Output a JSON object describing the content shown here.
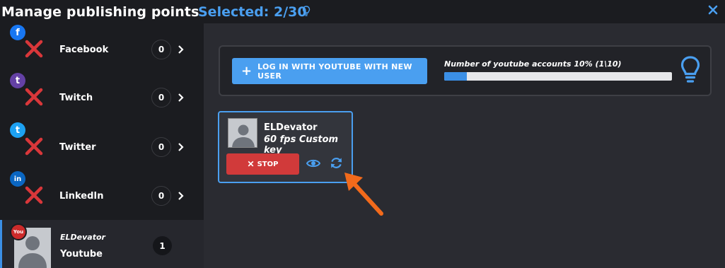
{
  "header": {
    "title": "Manage publishing points",
    "selected": "Selected: 2/30"
  },
  "sidebar": {
    "items": [
      {
        "name": "Facebook",
        "count": "0",
        "brand_icon": "facebook-icon",
        "brand_letter": "f",
        "color": "#1877f2"
      },
      {
        "name": "Twitch",
        "count": "0",
        "brand_icon": "twitch-icon",
        "brand_letter": "t",
        "color": "#6441a5"
      },
      {
        "name": "Twitter",
        "count": "0",
        "brand_icon": "twitter-icon",
        "brand_letter": "t",
        "color": "#1da1f2"
      },
      {
        "name": "LinkedIn",
        "count": "0",
        "brand_icon": "linkedin-icon",
        "brand_letter": "in",
        "color": "#0a66c2"
      }
    ],
    "active": {
      "account": "ELDevator",
      "name": "Youtube",
      "count": "1",
      "badge": "You"
    }
  },
  "main": {
    "login_plus": "+",
    "login_button": "LOG IN WITH YOUTUBE WITH NEW USER",
    "accounts_label": "Number of youtube accounts 10% (1\\10)",
    "accounts_progress": 0.1,
    "card": {
      "name": "ELDevator",
      "key": "60 fps Custom key",
      "stop_label": "STOP",
      "stop_x": "✕"
    }
  },
  "colors": {
    "accent": "#4a9ff0",
    "stop": "#d13a3a",
    "error": "#d9373a",
    "annotation_arrow": "#f26a1b"
  }
}
